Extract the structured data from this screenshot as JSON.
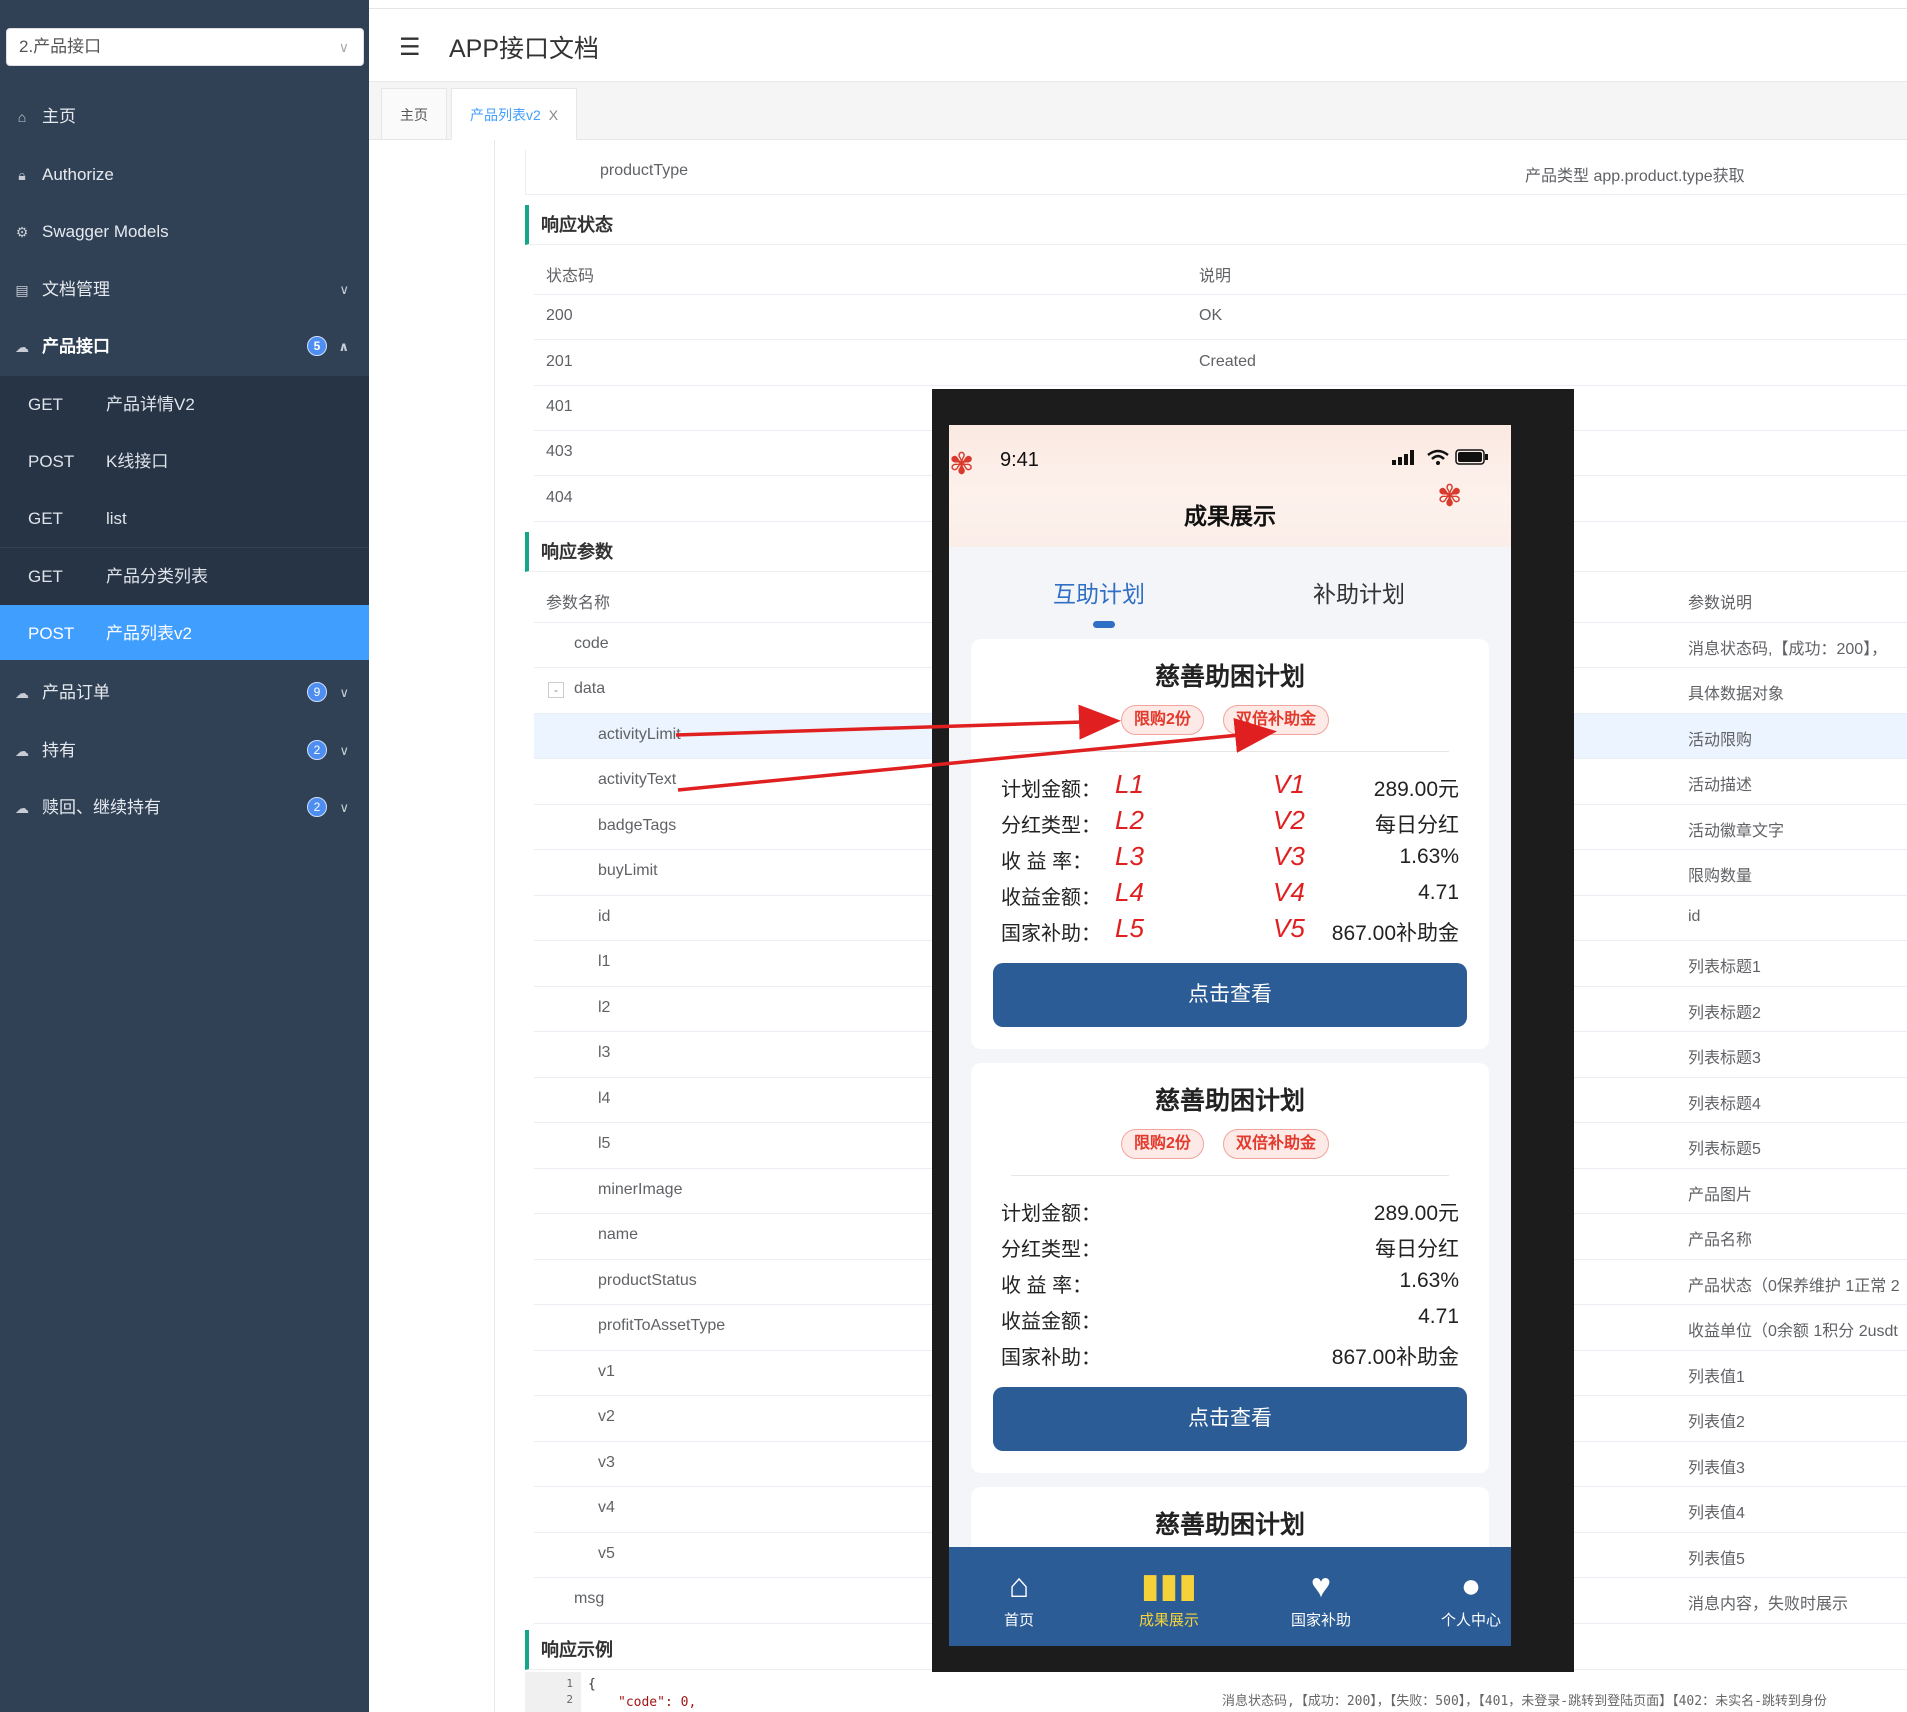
{
  "sidebar": {
    "selector": "2.产品接口",
    "items": [
      {
        "label": "主页",
        "icon": "home-icon"
      },
      {
        "label": "Authorize",
        "icon": "lock-icon"
      },
      {
        "label": "Swagger Models",
        "icon": "gear-icon"
      },
      {
        "label": "文档管理",
        "icon": "document-icon"
      },
      {
        "label": "产品接口",
        "icon": "cloud-icon",
        "badge": "5"
      },
      {
        "label": "产品订单",
        "icon": "cloud-icon",
        "badge": "9"
      },
      {
        "label": "持有",
        "icon": "cloud-icon",
        "badge": "2"
      },
      {
        "label": "赎回、继续持有",
        "icon": "cloud-icon",
        "badge": "2"
      }
    ],
    "sub_items": [
      {
        "method": "GET",
        "label": "产品详情V2"
      },
      {
        "method": "POST",
        "label": "K线接口"
      },
      {
        "method": "GET",
        "label": "list"
      },
      {
        "method": "GET",
        "label": "产品分类列表"
      },
      {
        "method": "POST",
        "label": "产品列表v2"
      }
    ]
  },
  "header": {
    "title": "APP接口文档"
  },
  "tabs": [
    {
      "label": "主页"
    },
    {
      "label": "产品列表v2",
      "close": "X"
    }
  ],
  "doc": {
    "top_row": {
      "name": "productType",
      "desc": "产品类型 app.product.type获取"
    },
    "response_status_title": "响应状态",
    "status_header": {
      "code": "状态码",
      "desc": "说明"
    },
    "status_rows": [
      {
        "code": "200",
        "desc": "OK"
      },
      {
        "code": "201",
        "desc": "Created"
      },
      {
        "code": "401",
        "desc": ""
      },
      {
        "code": "403",
        "desc": ""
      },
      {
        "code": "404",
        "desc": ""
      }
    ],
    "response_params_title": "响应参数",
    "params_header": {
      "name": "参数名称",
      "desc": "参数说明"
    },
    "params": [
      {
        "name": "code",
        "desc": "消息状态码,【成功：200】，"
      },
      {
        "name": "data",
        "desc": "具体数据对象",
        "toggle": "-"
      },
      {
        "name": "activityLimit",
        "desc": "活动限购"
      },
      {
        "name": "activityText",
        "desc": "活动描述"
      },
      {
        "name": "badgeTags",
        "desc": "活动徽章文字"
      },
      {
        "name": "buyLimit",
        "desc": "限购数量"
      },
      {
        "name": "id",
        "desc": "id"
      },
      {
        "name": "l1",
        "desc": "列表标题1"
      },
      {
        "name": "l2",
        "desc": "列表标题2"
      },
      {
        "name": "l3",
        "desc": "列表标题3"
      },
      {
        "name": "l4",
        "desc": "列表标题4"
      },
      {
        "name": "l5",
        "desc": "列表标题5"
      },
      {
        "name": "minerImage",
        "desc": "产品图片"
      },
      {
        "name": "name",
        "desc": "产品名称"
      },
      {
        "name": "productStatus",
        "desc": "产品状态（0保养维护 1正常 2"
      },
      {
        "name": "profitToAssetType",
        "desc": "收益单位（0余额 1积分 2usdt"
      },
      {
        "name": "v1",
        "desc": "列表值1"
      },
      {
        "name": "v2",
        "desc": "列表值2"
      },
      {
        "name": "v3",
        "desc": "列表值3"
      },
      {
        "name": "v4",
        "desc": "列表值4"
      },
      {
        "name": "v5",
        "desc": "列表值5"
      },
      {
        "name": "msg",
        "desc": "消息内容，失败时展示"
      }
    ],
    "response_example_title": "响应示例",
    "code_gutter": [
      "1",
      "2"
    ],
    "code_lines": [
      "{",
      "\"code\": 0,"
    ],
    "bottom_note": "消息状态码,【成功：200】，【失败：500】，【401，未登录-跳转到登陆页面】【402：未实名-跳转到身份"
  },
  "phone": {
    "time": "9:41",
    "status_icons": "signal wifi battery",
    "title": "成果展示",
    "tabs": [
      {
        "label": "互助计划",
        "active": true
      },
      {
        "label": "补助计划",
        "active": false
      }
    ],
    "cards": [
      {
        "title": "慈善助困计划",
        "tags": [
          "限购2份",
          "双倍补助金"
        ],
        "rows": [
          {
            "key": "计划金额：",
            "value": "289.00元",
            "lmark": "L1",
            "vmark": "V1"
          },
          {
            "key": "分红类型：",
            "value": "每日分红",
            "lmark": "L2",
            "vmark": "V2"
          },
          {
            "key": "收 益 率：",
            "value": "1.63%",
            "lmark": "L3",
            "vmark": "V3"
          },
          {
            "key": "收益金额：",
            "value": "4.71",
            "lmark": "L4",
            "vmark": "V4"
          },
          {
            "key": "国家补助：",
            "value": "867.00补助金",
            "lmark": "L5",
            "vmark": "V5"
          }
        ],
        "button": "点击查看"
      },
      {
        "title": "慈善助困计划",
        "tags": [
          "限购2份",
          "双倍补助金"
        ],
        "rows": [
          {
            "key": "计划金额：",
            "value": "289.00元"
          },
          {
            "key": "分红类型：",
            "value": "每日分红"
          },
          {
            "key": "收 益 率：",
            "value": "1.63%"
          },
          {
            "key": "收益金额：",
            "value": "4.71"
          },
          {
            "key": "国家补助：",
            "value": "867.00补助金"
          }
        ],
        "button": "点击查看"
      },
      {
        "title": "慈善助困计划"
      }
    ],
    "tabbar": [
      {
        "label": "首页",
        "icon": "home-icon"
      },
      {
        "label": "成果展示",
        "icon": "bar-chart-icon",
        "active": true
      },
      {
        "label": "国家补助",
        "icon": "hand-heart-icon"
      },
      {
        "label": "个人中心",
        "icon": "user-icon"
      }
    ]
  },
  "colors": {
    "sidebar": "#304156",
    "active": "#409eff",
    "accent_green": "#17a589",
    "phone_primary": "#2c5c95",
    "annotation_red": "#e02020"
  }
}
